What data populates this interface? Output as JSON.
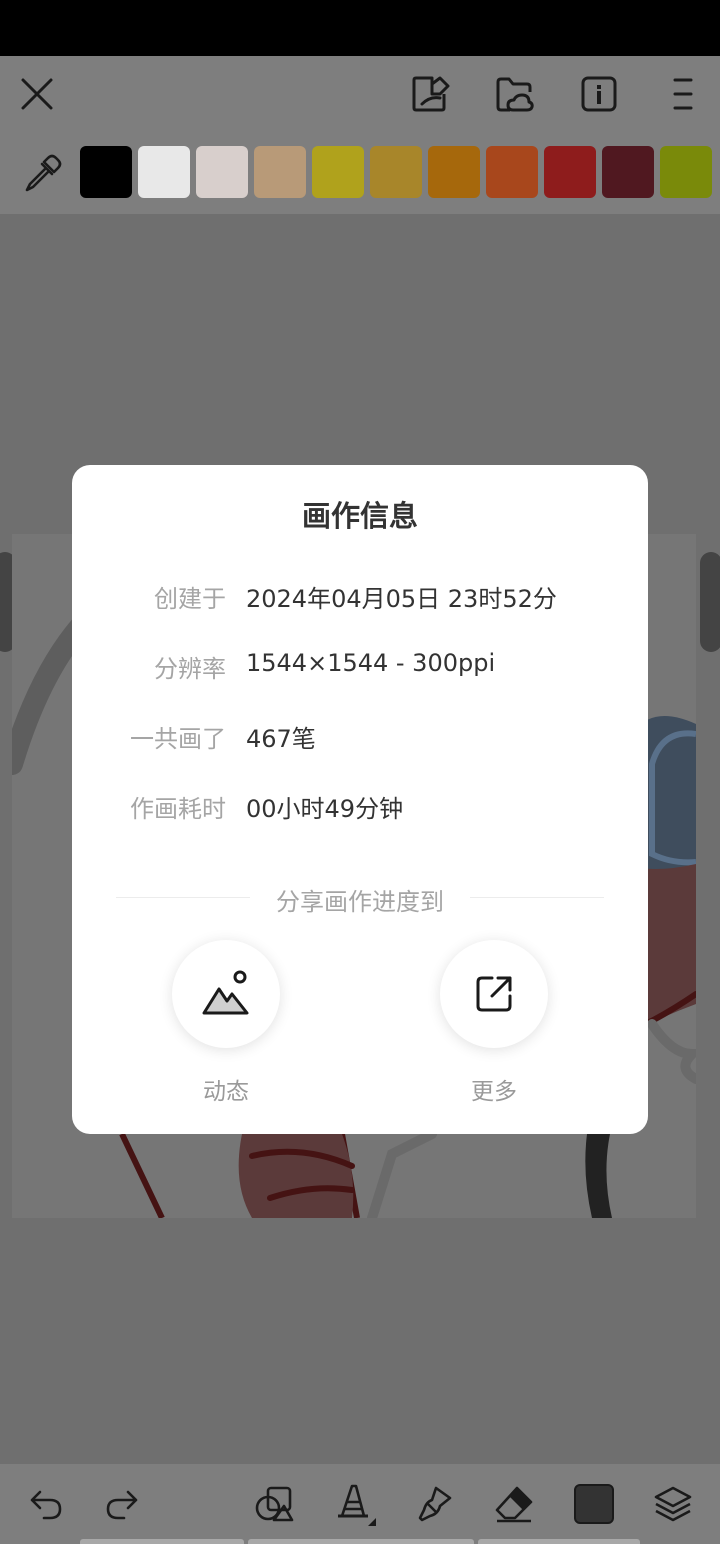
{
  "dialog": {
    "title": "画作信息",
    "rows": [
      {
        "label": "创建于",
        "value": "2024年04月05日 23时52分"
      },
      {
        "label": "分辨率",
        "value": "1544×1544 - 300ppi"
      },
      {
        "label": "一共画了",
        "value": "467笔"
      },
      {
        "label": "作画耗时",
        "value": "00小时49分钟"
      }
    ],
    "share_title": "分享画作进度到",
    "share_buttons": [
      {
        "label": "动态",
        "icon": "mountain-photo-icon"
      },
      {
        "label": "更多",
        "icon": "external-share-icon"
      }
    ]
  },
  "toolbar": {
    "icons": [
      "close-icon",
      "sticker-icon",
      "cloud-folder-icon",
      "info-icon",
      "menu-icon"
    ]
  },
  "palette": {
    "icon": "eyedropper-icon",
    "colors": [
      "#000000",
      "#e8e8e8",
      "#d8cfcc",
      "#b89a78",
      "#b0a21c",
      "#a8862a",
      "#a6680c",
      "#a8471c",
      "#8e1c1c",
      "#501820",
      "#7a8a0a"
    ]
  },
  "bottom_toolbar": {
    "icons": [
      "undo-icon",
      "redo-icon",
      "shapes-icon",
      "brush-icon",
      "smudge-icon",
      "eraser-icon",
      "current-color-swatch",
      "layers-icon"
    ],
    "current_color": "#333333"
  }
}
